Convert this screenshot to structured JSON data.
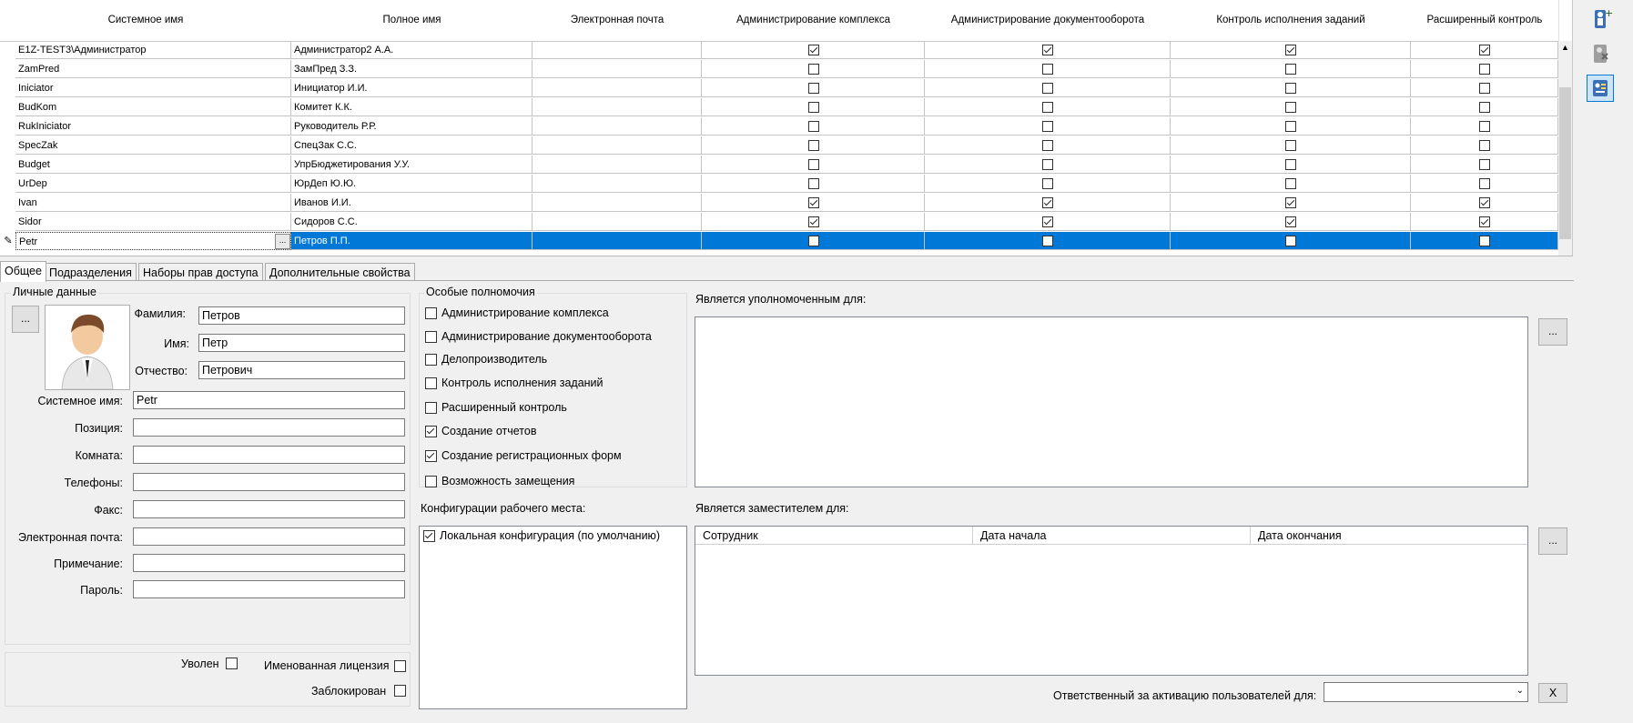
{
  "grid": {
    "columns": [
      "Системное имя",
      "Полное имя",
      "Электронная почта",
      "Администрирование комплекса",
      "Администрирование документооборота",
      "Контроль исполнения заданий",
      "Расширенный контроль"
    ],
    "rows": [
      {
        "sys": "E1Z-TEST3\\Администратор",
        "full": "Администратор2 А.А.",
        "email": "",
        "checks": [
          true,
          true,
          true,
          true
        ]
      },
      {
        "sys": "ZamPred",
        "full": "ЗамПред З.З.",
        "email": "",
        "checks": [
          false,
          false,
          false,
          false
        ]
      },
      {
        "sys": "Iniciator",
        "full": "Инициатор И.И.",
        "email": "",
        "checks": [
          false,
          false,
          false,
          false
        ]
      },
      {
        "sys": "BudKom",
        "full": "Комитет К.К.",
        "email": "",
        "checks": [
          false,
          false,
          false,
          false
        ]
      },
      {
        "sys": "RukIniciator",
        "full": "Руководитель Р.Р.",
        "email": "",
        "checks": [
          false,
          false,
          false,
          false
        ]
      },
      {
        "sys": "SpecZak",
        "full": "СпецЗак С.С.",
        "email": "",
        "checks": [
          false,
          false,
          false,
          false
        ]
      },
      {
        "sys": "Budget",
        "full": "УпрБюджетирования У.У.",
        "email": "",
        "checks": [
          false,
          false,
          false,
          false
        ]
      },
      {
        "sys": "UrDep",
        "full": "ЮрДеп Ю.Ю.",
        "email": "",
        "checks": [
          false,
          false,
          false,
          false
        ]
      },
      {
        "sys": "Ivan",
        "full": "Иванов И.И.",
        "email": "",
        "checks": [
          true,
          true,
          true,
          true
        ]
      },
      {
        "sys": "Sidor",
        "full": "Сидоров С.С.",
        "email": "",
        "checks": [
          true,
          true,
          true,
          true
        ]
      },
      {
        "sys": "Petr",
        "full": "Петров П.П.",
        "email": "",
        "checks": [
          false,
          false,
          false,
          false
        ],
        "selected": true
      }
    ],
    "edit_button": "...",
    "edit_marker": "✎"
  },
  "tabs": [
    "Общее",
    "Подразделения",
    "Наборы прав доступа",
    "Дополнительные свойства"
  ],
  "personal": {
    "title": "Личные данные",
    "photo_button": "...",
    "fields": [
      {
        "label": "Фамилия:",
        "value": "Петров"
      },
      {
        "label": "Имя:",
        "value": "Петр"
      },
      {
        "label": "Отчество:",
        "value": "Петрович"
      }
    ],
    "fields2": [
      {
        "label": "Системное имя:",
        "value": "Petr"
      },
      {
        "label": "Позиция:",
        "value": ""
      },
      {
        "label": "Комната:",
        "value": ""
      },
      {
        "label": "Телефоны:",
        "value": ""
      },
      {
        "label": "Факс:",
        "value": ""
      },
      {
        "label": "Электронная почта:",
        "value": ""
      },
      {
        "label": "Примечание:",
        "value": ""
      },
      {
        "label": "Пароль:",
        "value": ""
      }
    ]
  },
  "flags": {
    "fired": "Уволен",
    "named_license": "Именованная лицензия",
    "blocked": "Заблокирован"
  },
  "special": {
    "title": "Особые полномочия",
    "items": [
      {
        "label": "Администрирование комплекса",
        "checked": false
      },
      {
        "label": "Администрирование документооборота",
        "checked": false
      },
      {
        "label": "Делопроизводитель",
        "checked": false
      },
      {
        "label": "Контроль исполнения заданий",
        "checked": false
      },
      {
        "label": "Расширенный контроль",
        "checked": false
      },
      {
        "label": "Создание отчетов",
        "checked": true
      },
      {
        "label": "Создание регистрационных форм",
        "checked": true
      },
      {
        "label": "Возможность замещения",
        "checked": false
      }
    ]
  },
  "config": {
    "title": "Конфигурации рабочего места:",
    "items": [
      {
        "label": "Локальная конфигурация (по умолчанию)",
        "checked": true
      }
    ]
  },
  "authorized": {
    "title": "Является уполномоченным для:",
    "button": "..."
  },
  "deputy": {
    "title": "Является заместителем для:",
    "columns": [
      "Сотрудник",
      "Дата начала",
      "Дата окончания"
    ],
    "button": "..."
  },
  "activation": {
    "label": "Ответственный за активацию пользователей для:",
    "value": "",
    "clear_button": "X"
  },
  "colors": {
    "selection": "#0078d7",
    "accent": "#0078d7"
  }
}
